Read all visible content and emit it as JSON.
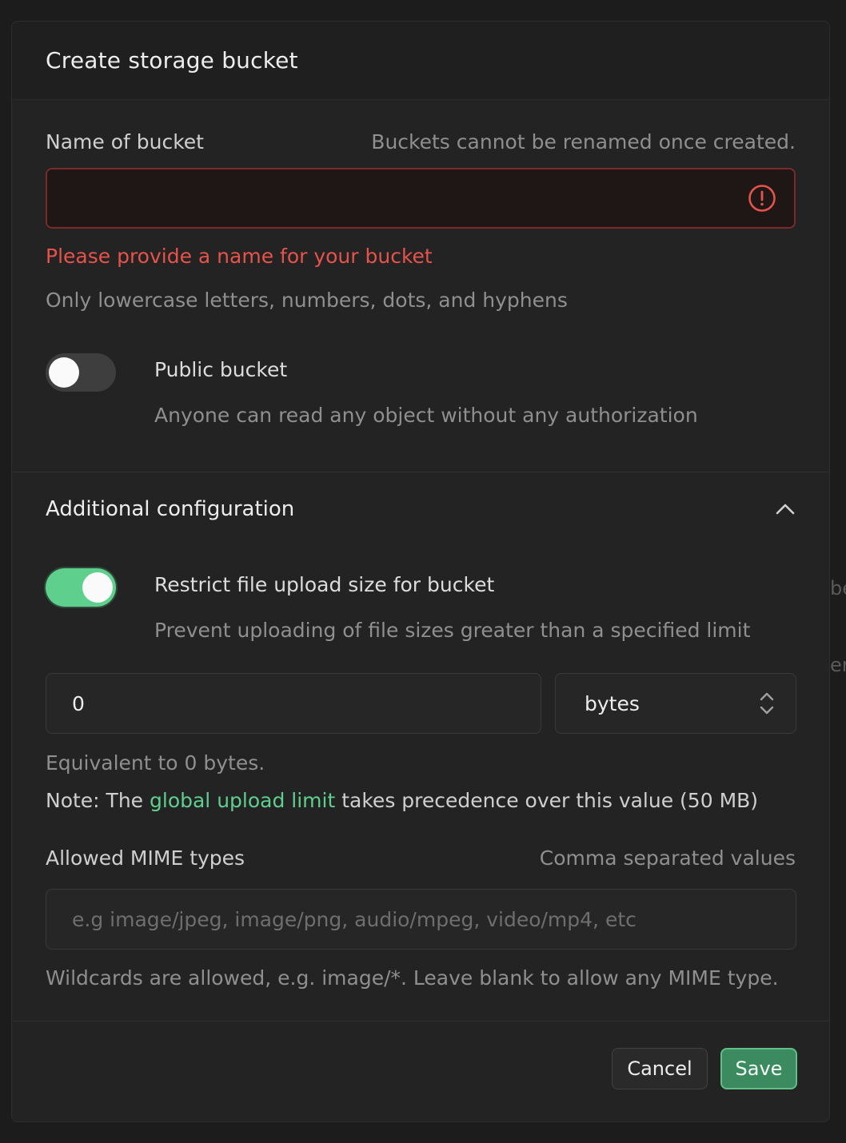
{
  "modal": {
    "title": "Create storage bucket"
  },
  "name_field": {
    "label": "Name of bucket",
    "hint": "Buckets cannot be renamed once created.",
    "value": "",
    "error": "Please provide a name for your bucket",
    "help": "Only lowercase letters, numbers, dots, and hyphens"
  },
  "public_toggle": {
    "enabled": false,
    "title": "Public bucket",
    "description": "Anyone can read any object without any authorization"
  },
  "additional": {
    "title": "Additional configuration",
    "expanded": true,
    "restrict_toggle": {
      "enabled": true,
      "title": "Restrict file upload size for bucket",
      "description": "Prevent uploading of file sizes greater than a specified limit"
    },
    "size_value": "0",
    "size_unit": "bytes",
    "equivalent": "Equivalent to 0 bytes.",
    "note_prefix": "Note: The ",
    "note_link": "global upload limit",
    "note_suffix": " takes precedence over this value (50 MB)",
    "mime": {
      "label": "Allowed MIME types",
      "hint": "Comma separated values",
      "placeholder": "e.g image/jpeg, image/png, audio/mpeg, video/mp4, etc",
      "help": "Wildcards are allowed, e.g. image/*. Leave blank to allow any MIME type."
    }
  },
  "footer": {
    "cancel_label": "Cancel",
    "save_label": "Save"
  },
  "colors": {
    "error": "#e5534b",
    "accent": "#5fcf8e",
    "save_button": "#3c8a5f"
  },
  "icons": [
    "alert-circle-icon",
    "chevron-up-icon",
    "select-arrows-icon"
  ]
}
